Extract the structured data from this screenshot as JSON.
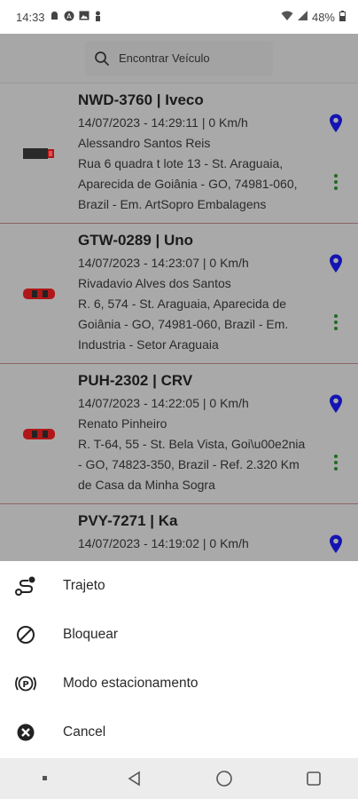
{
  "status_bar": {
    "time": "14:33",
    "battery": "48%"
  },
  "search": {
    "placeholder": "Encontrar Veículo",
    "icon": "search-icon"
  },
  "vehicles": [
    {
      "plate": "NWD-3760 | Iveco",
      "datetime": "14/07/2023 - 14:29:11 | 0 Km/h",
      "driver": "Alessandro Santos Reis",
      "address_lines": [
        "Rua 6 quadra t lote 13 - St. Araguaia,",
        "Aparecida de Goiânia - GO, 74981-060,",
        "Brazil - Em. ArtSopro Embalagens"
      ],
      "icon": "truck-icon"
    },
    {
      "plate": "GTW-0289 | Uno",
      "datetime": "14/07/2023 - 14:23:07 | 0 Km/h",
      "driver": "Rivadavio Alves dos Santos",
      "address_lines": [
        "R. 6, 574 - St. Araguaia, Aparecida de",
        "Goiânia - GO, 74981-060, Brazil - Em.",
        "Industria - Setor Araguaia"
      ],
      "icon": "car-icon"
    },
    {
      "plate": "PUH-2302 | CRV",
      "datetime": "14/07/2023 - 14:22:05 | 0 Km/h",
      "driver": "Renato Pinheiro",
      "address_lines": [
        "R. T-64, 55 - St. Bela Vista, Goi\\u00e2nia",
        "- GO, 74823-350, Brazil - Ref. 2.320 Km",
        "de Casa da Minha Sogra"
      ],
      "icon": "car-icon"
    },
    {
      "plate": "PVY-7271 | Ka",
      "datetime": "14/07/2023 - 14:19:02 | 0 Km/h",
      "driver": "",
      "address_lines": [],
      "icon": "car-icon"
    }
  ],
  "bottom_sheet": {
    "items": [
      {
        "label": "Trajeto",
        "icon": "route-icon"
      },
      {
        "label": "Bloquear",
        "icon": "block-icon"
      },
      {
        "label": "Modo estacionamento",
        "icon": "parking-icon"
      },
      {
        "label": "Cancel",
        "icon": "cancel-icon"
      }
    ]
  },
  "colors": {
    "pin": "#1414b4",
    "kebab": "#1f6b1f",
    "car_red": "#b01818",
    "divider": "#8a6565"
  }
}
